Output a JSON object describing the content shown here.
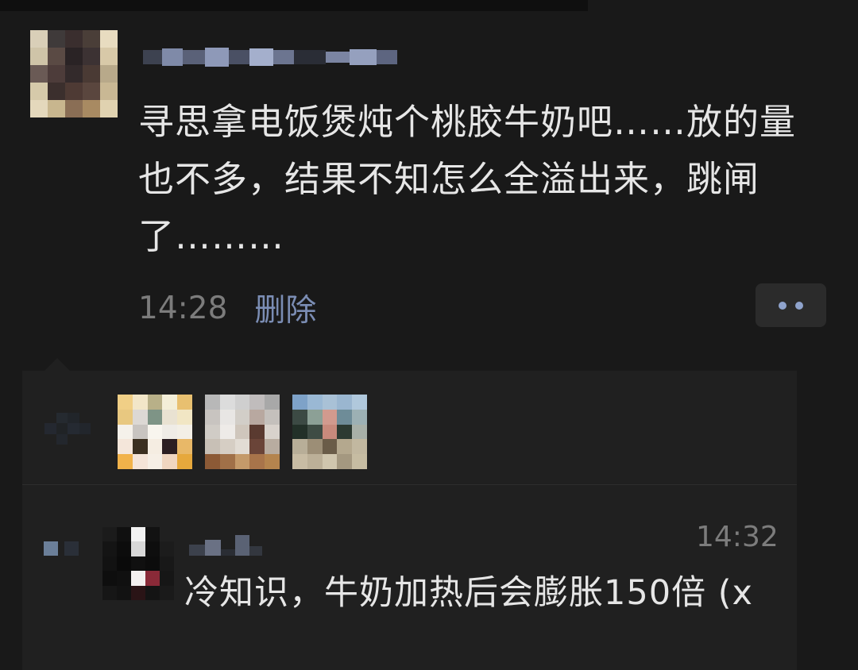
{
  "post": {
    "text": "寻思拿电饭煲炖个桃胶牛奶吧……放的量也不多，结果不知怎么全溢出来，跳闸了………",
    "time": "14:28",
    "delete_label": "删除"
  },
  "comment": {
    "time": "14:32",
    "text": "冷知识，牛奶加热后会膨胀150倍 (x"
  },
  "colors": {
    "background": "#191919",
    "panel": "#202020",
    "text": "#e6e6e6",
    "link": "#7b8db4",
    "muted": "#7c7c7c"
  },
  "icons": {
    "more": "more-dots-icon",
    "like": "heart-icon",
    "comment": "comment-icon"
  }
}
